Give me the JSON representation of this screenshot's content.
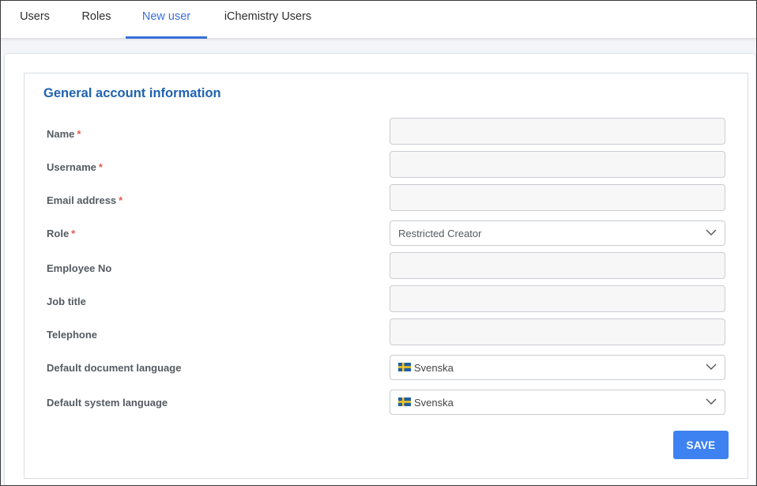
{
  "tabs": [
    {
      "label": "Users",
      "active": false
    },
    {
      "label": "Roles",
      "active": false
    },
    {
      "label": "New user",
      "active": true
    },
    {
      "label": "iChemistry Users",
      "active": false
    }
  ],
  "section": {
    "title": "General account information"
  },
  "form": {
    "required_mark": "*",
    "name": {
      "label": "Name",
      "value": "",
      "required": true
    },
    "username": {
      "label": "Username",
      "value": "",
      "required": true
    },
    "email": {
      "label": "Email address",
      "value": "",
      "required": true
    },
    "role": {
      "label": "Role",
      "value": "Restricted Creator",
      "required": true
    },
    "employee_no": {
      "label": "Employee No",
      "value": ""
    },
    "job_title": {
      "label": "Job title",
      "value": ""
    },
    "telephone": {
      "label": "Telephone",
      "value": ""
    },
    "doc_language": {
      "label": "Default document language",
      "value": "Svenska",
      "flag_icon": "sweden-flag-icon"
    },
    "sys_language": {
      "label": "Default system language",
      "value": "Svenska",
      "flag_icon": "sweden-flag-icon"
    }
  },
  "actions": {
    "save_label": "SAVE"
  },
  "colors": {
    "accent": "#3a6fd8",
    "title": "#1f63b0",
    "save_button": "#3d82f0",
    "required": "#e05d4d"
  }
}
